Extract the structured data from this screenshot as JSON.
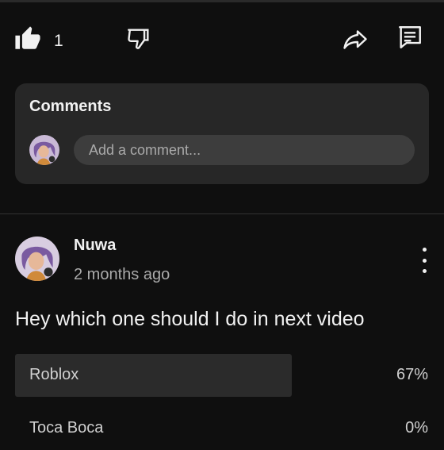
{
  "actions": {
    "like_count": "1"
  },
  "comments": {
    "title": "Comments",
    "placeholder": "Add a comment..."
  },
  "post": {
    "author": "Nuwa",
    "time": "2 months ago",
    "text": "Hey which one should I do in next video",
    "poll": [
      {
        "label": "Roblox",
        "percent_text": "67%",
        "fraction": 0.67
      },
      {
        "label": "Toca Boca",
        "percent_text": "0%",
        "fraction": 0.0
      }
    ]
  },
  "icons": {
    "like": "thumbs-up-icon",
    "dislike": "thumbs-down-icon",
    "share": "share-icon",
    "feedback": "feedback-icon",
    "more": "more-vert-icon"
  },
  "colors": {
    "background": "#0f0f0f",
    "card": "#272727",
    "input": "#3d3d3d",
    "text_primary": "#f1f1f1",
    "text_secondary": "#aaaaaa",
    "poll_fill": "#2b2b2b"
  }
}
